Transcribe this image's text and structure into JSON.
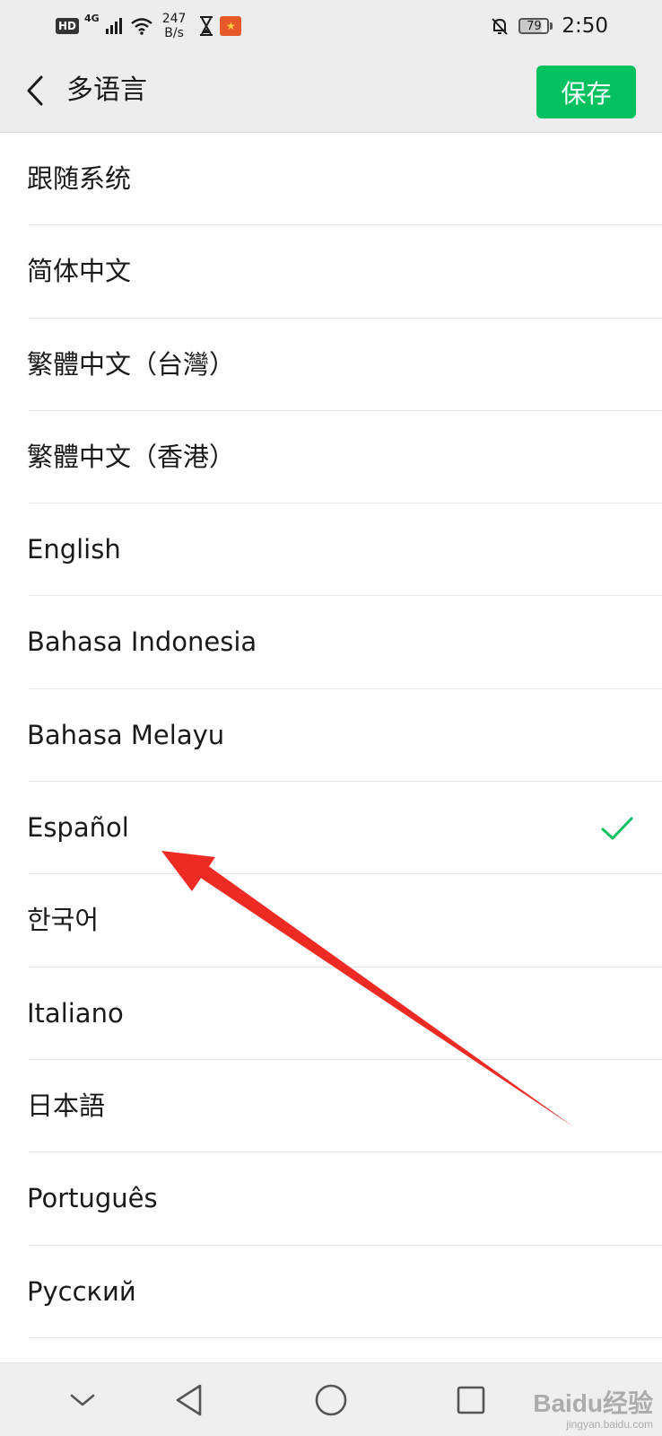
{
  "status_bar": {
    "hd": "HD",
    "network": "4G",
    "speed_value": "247",
    "speed_unit": "B/s",
    "battery": "79",
    "time": "2:50"
  },
  "header": {
    "title": "多语言",
    "save_label": "保存"
  },
  "languages": [
    {
      "label": "跟随系统"
    },
    {
      "label": "简体中文"
    },
    {
      "label": "繁體中文（台灣）"
    },
    {
      "label": "繁體中文（香港）"
    },
    {
      "label": "English"
    },
    {
      "label": "Bahasa Indonesia"
    },
    {
      "label": "Bahasa Melayu"
    },
    {
      "label": "Español",
      "selected": true
    },
    {
      "label": "한국어"
    },
    {
      "label": "Italiano"
    },
    {
      "label": "日本語"
    },
    {
      "label": "Português"
    },
    {
      "label": "Русский"
    }
  ],
  "colors": {
    "accent": "#07c160",
    "annotation_arrow": "#ee2a24",
    "header_bg": "#ededed"
  },
  "icons": {
    "back": "chevron-left-icon",
    "check": "checkmark-icon",
    "nav_hide": "chevron-down-icon",
    "nav_back": "triangle-back-icon",
    "nav_home": "circle-home-icon",
    "nav_recents": "square-recents-icon"
  },
  "watermark": {
    "main": "Baidu经验",
    "sub": "jingyan.baidu.com"
  }
}
